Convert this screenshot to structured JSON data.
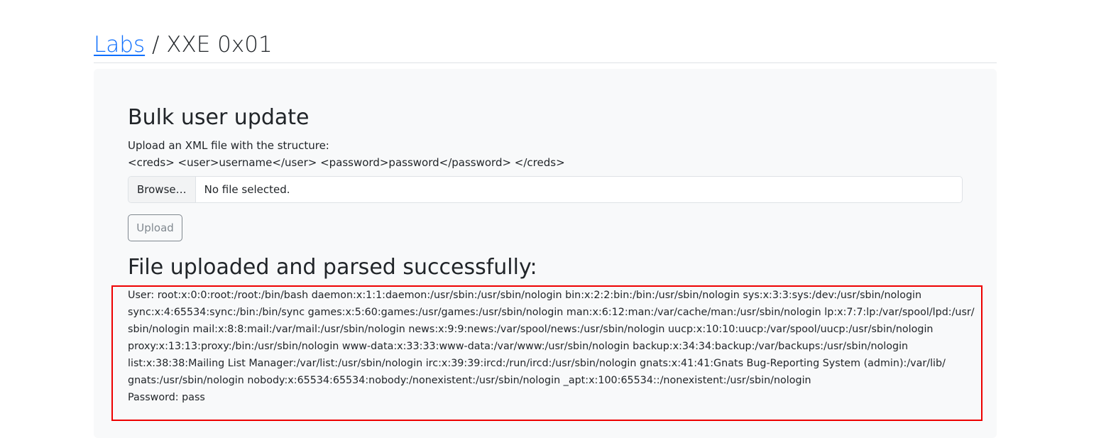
{
  "breadcrumb": {
    "link_label": "Labs",
    "separator": " / ",
    "current": "XXE 0x01"
  },
  "form": {
    "title": "Bulk user update",
    "description": "Upload an XML file with the structure:",
    "structure": "<creds> <user>username</user> <password>password</password> </creds>",
    "browse_label": "Browse…",
    "file_status": "No file selected.",
    "upload_label": "Upload"
  },
  "result": {
    "title": "File uploaded and parsed successfully:",
    "user_lines": [
      "User: root:x:0:0:root:/root:/bin/bash daemon:x:1:1:daemon:/usr/sbin:/usr/sbin/nologin bin:x:2:2:bin:/bin:/usr/sbin/nologin sys:x:3:3:sys:/dev:/usr/sbin/nologin",
      "sync:x:4:65534:sync:/bin:/bin/sync games:x:5:60:games:/usr/games:/usr/sbin/nologin man:x:6:12:man:/var/cache/man:/usr/sbin/nologin lp:x:7:7:lp:/var/spool/lpd:/usr/",
      "sbin/nologin mail:x:8:8:mail:/var/mail:/usr/sbin/nologin news:x:9:9:news:/var/spool/news:/usr/sbin/nologin uucp:x:10:10:uucp:/var/spool/uucp:/usr/sbin/nologin",
      "proxy:x:13:13:proxy:/bin:/usr/sbin/nologin www-data:x:33:33:www-data:/var/www:/usr/sbin/nologin backup:x:34:34:backup:/var/backups:/usr/sbin/nologin",
      "list:x:38:38:Mailing List Manager:/var/list:/usr/sbin/nologin irc:x:39:39:ircd:/run/ircd:/usr/sbin/nologin gnats:x:41:41:Gnats Bug-Reporting System (admin):/var/lib/",
      "gnats:/usr/sbin/nologin nobody:x:65534:65534:nobody:/nonexistent:/usr/sbin/nologin _apt:x:100:65534::/nonexistent:/usr/sbin/nologin"
    ],
    "password_line": "Password: pass"
  },
  "colors": {
    "link": "#0d6efd",
    "highlight_border": "#ee0000",
    "card_background": "#f8f9fa"
  }
}
